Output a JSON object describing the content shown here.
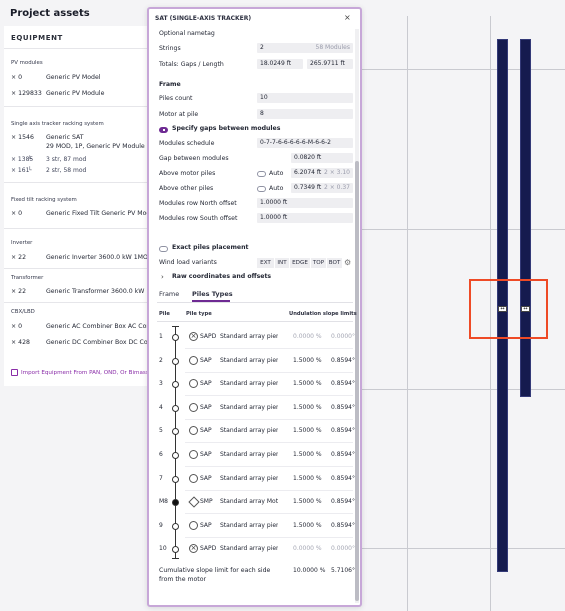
{
  "assets": {
    "title": "Project assets",
    "equipment_header": "EQUIPMENT",
    "groups": {
      "pv": "PV modules",
      "sat": "Single axis tracker racking system",
      "ft": "Fixed tilt racking system",
      "inv": "Inverter",
      "tr": "Transformer",
      "cbx": "CBX/LBD"
    },
    "rows": {
      "pv_model_q": "× 0",
      "pv_model": "Generic PV Model",
      "pv_module_q": "× 129833",
      "pv_module": "Generic PV Module",
      "sat_q": "× 1546",
      "sat_name": "Generic SAT",
      "sat_desc": "29 MOD, 1P, Generic PV Module",
      "sat_sub1_q": "× 1385",
      "sat_sub1": "3 str, 87 mod",
      "sat_sub2_q": "× 161",
      "sat_sub2": "2 str, 58 mod",
      "ft_q": "× 0",
      "ft": "Generic Fixed Tilt Generic PV Mod",
      "inv_q": "× 22",
      "inv": "Generic Inverter 3600.0 kW 1MOD",
      "tr_q": "× 22",
      "tr": "Generic Transformer 3600.0 kW",
      "cbx1_q": "× 0",
      "cbx1": "Generic AC Combiner Box AC Com",
      "cbx2_q": "× 428",
      "cbx2": "Generic DC Combiner Box DC Comb"
    },
    "import_link": "Import Equipment From PAN, OND, Or Bimasse"
  },
  "dialog": {
    "title": "SAT (SINGLE-AXIS TRACKER)",
    "close": "×",
    "optional_nametag": "Optional nametag",
    "strings_label": "Strings",
    "strings_value": "2",
    "strings_modules": "58 Modules",
    "totals_label": "Totals: Gaps / Length",
    "totals_gaps": "18.0249 ft",
    "totals_length": "265.9711 ft",
    "frame_header": "Frame",
    "piles_count_label": "Piles count",
    "piles_count_value": "10",
    "motor_label": "Motor at pile",
    "motor_value": "8",
    "specify_gaps_label": "Specify gaps between modules",
    "modules_schedule_label": "Modules schedule",
    "modules_schedule_value": "0-7-7-6-6-6-6-6-M-6-6-2",
    "gap_label": "Gap between modules",
    "gap_value": "0.0820 ft",
    "above_motor_label": "Above motor piles",
    "above_motor_auto": "Auto",
    "above_motor_value": "6.2074 ft",
    "above_motor_hint": "2 × 3.10",
    "above_other_label": "Above other piles",
    "above_other_auto": "Auto",
    "above_other_value": "0.7349 ft",
    "above_other_hint": "2 × 0.37",
    "north_label": "Modules row North offset",
    "north_value": "1.0000 ft",
    "south_label": "Modules row South offset",
    "south_value": "1.0000 ft",
    "exact_piles_label": "Exact piles placement",
    "wind_label": "Wind load variants",
    "wind_options": [
      "EXT",
      "INT",
      "EDGE",
      "TOP",
      "BOT"
    ],
    "raw_coords_label": "Raw coordinates and offsets",
    "tabs": [
      "Frame",
      "Piles Types"
    ],
    "table_headers": {
      "pile": "Pile",
      "type": "Pile type",
      "slope": "Undulation slope limits"
    },
    "piles": [
      {
        "n": "1",
        "abbr": "SAPD",
        "name": "Standard array pier Da",
        "pct": "0.0000 %",
        "deg": "0.0000°"
      },
      {
        "n": "2",
        "abbr": "SAP",
        "name": "Standard array pier Da",
        "pct": "1.5000 %",
        "deg": "0.8594°"
      },
      {
        "n": "3",
        "abbr": "SAP",
        "name": "Standard array pier",
        "pct": "1.5000 %",
        "deg": "0.8594°"
      },
      {
        "n": "4",
        "abbr": "SAP",
        "name": "Standard array pier",
        "pct": "1.5000 %",
        "deg": "0.8594°"
      },
      {
        "n": "5",
        "abbr": "SAP",
        "name": "Standard array pier",
        "pct": "1.5000 %",
        "deg": "0.8594°"
      },
      {
        "n": "6",
        "abbr": "SAP",
        "name": "Standard array pier",
        "pct": "1.5000 %",
        "deg": "0.8594°"
      },
      {
        "n": "7",
        "abbr": "SAP",
        "name": "Standard array pier",
        "pct": "1.5000 %",
        "deg": "0.8594°"
      },
      {
        "n": "M8",
        "abbr": "SMP",
        "name": "Standard array Motor p",
        "pct": "1.5000 %",
        "deg": "0.8594°"
      },
      {
        "n": "9",
        "abbr": "SAP",
        "name": "Standard array pier",
        "pct": "1.5000 %",
        "deg": "0.8594°"
      },
      {
        "n": "10",
        "abbr": "SAPD",
        "name": "Standard array pier Da",
        "pct": "0.0000 %",
        "deg": "0.0000°"
      }
    ],
    "cumulative_label": "Cumulative slope limit for each side from the motor",
    "cumulative_pct": "10.0000 %",
    "cumulative_deg": "5.7106°"
  },
  "colors": {
    "accent": "#6e2a93",
    "tracker": "#151b4f",
    "selection": "#ee4a26"
  }
}
